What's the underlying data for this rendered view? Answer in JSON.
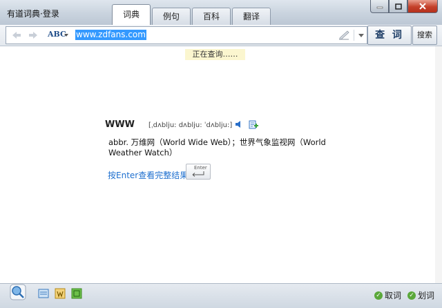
{
  "app": {
    "title": "有道词典",
    "dot": "·",
    "login": "登录"
  },
  "tabs": [
    "词典",
    "例句",
    "百科",
    "翻译"
  ],
  "window_buttons": {
    "minimize": "minimize-icon",
    "maximize": "maximize-icon",
    "close": "close-icon"
  },
  "search": {
    "abc_label": "ABC",
    "query": "www.zdfans.com",
    "search_button": "查 词",
    "search2_button": "搜索"
  },
  "status_tip": "正在查询……",
  "result": {
    "word": "WWW",
    "phonetic": "[ˌdʌblju: dʌblju: ˈdʌblju:]",
    "definition": "abbr. 万维网（World Wide Web）；世界气象监视网（World Weather Watch）",
    "enter_link": "按Enter查看完整结果",
    "enter_key": "Enter"
  },
  "bottom": {
    "option1": "取词",
    "option2": "划词"
  },
  "colors": {
    "accent": "#3399ff",
    "link": "#1e6fcf",
    "check": "#5aa83a",
    "close": "#c4402a"
  }
}
